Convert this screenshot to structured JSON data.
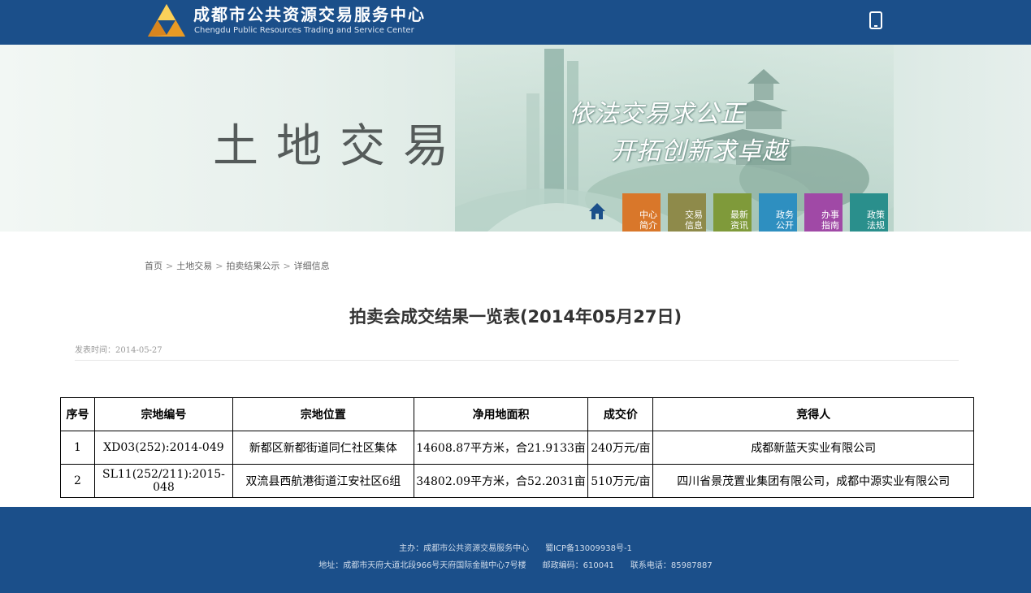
{
  "header": {
    "site_name": "成都市公共资源交易服务中心",
    "site_name_en": "Chengdu Public Resources Trading and Service Center",
    "brand_color": "#1b4f8a",
    "mobile_icon": "mobile-phone-icon"
  },
  "banner": {
    "title": "土地交易",
    "slogan_line1": "依法交易求公正",
    "slogan_line2": "开拓创新求卓越",
    "home_icon": "home-icon",
    "nav": [
      {
        "label_1": "中心",
        "label_2": "简介",
        "color": "#d9772a"
      },
      {
        "label_1": "交易",
        "label_2": "信息",
        "color": "#8e8a4a"
      },
      {
        "label_1": "最新",
        "label_2": "资讯",
        "color": "#7f9a3a"
      },
      {
        "label_1": "政务",
        "label_2": "公开",
        "color": "#2e8fc0"
      },
      {
        "label_1": "办事",
        "label_2": "指南",
        "color": "#a049a6"
      },
      {
        "label_1": "政策",
        "label_2": "法规",
        "color": "#2a8f8c"
      }
    ]
  },
  "breadcrumb": {
    "items": [
      "首页",
      "土地交易",
      "拍卖结果公示",
      "详细信息"
    ],
    "separator": ">"
  },
  "article": {
    "title": "拍卖会成交结果一览表(2014年05月27日)",
    "publish_label": "发表时间：",
    "publish_date": "2014-05-27"
  },
  "table": {
    "headers": [
      "序号",
      "宗地编号",
      "宗地位置",
      "净用地面积",
      "成交价",
      "竞得人"
    ],
    "rows": [
      [
        "1",
        "XD03(252):2014-049",
        "新都区新都街道同仁社区集体",
        "14608.87平方米，合21.9133亩",
        "240万元/亩",
        "成都新蓝天实业有限公司"
      ],
      [
        "2",
        "SL11(252/211):2015-048",
        "双流县西航港街道江安社区6组",
        "34802.09平方米，合52.2031亩",
        "510万元/亩",
        "四川省景茂置业集团有限公司，成都中源实业有限公司"
      ]
    ]
  },
  "footer": {
    "host": "主办：成都市公共资源交易服务中心",
    "icp": "蜀ICP备13009938号-1",
    "address": "地址：成都市天府大道北段966号天府国际金融中心7号楼",
    "postcode": "邮政编码：610041",
    "phone": "联系电话：85987887"
  }
}
